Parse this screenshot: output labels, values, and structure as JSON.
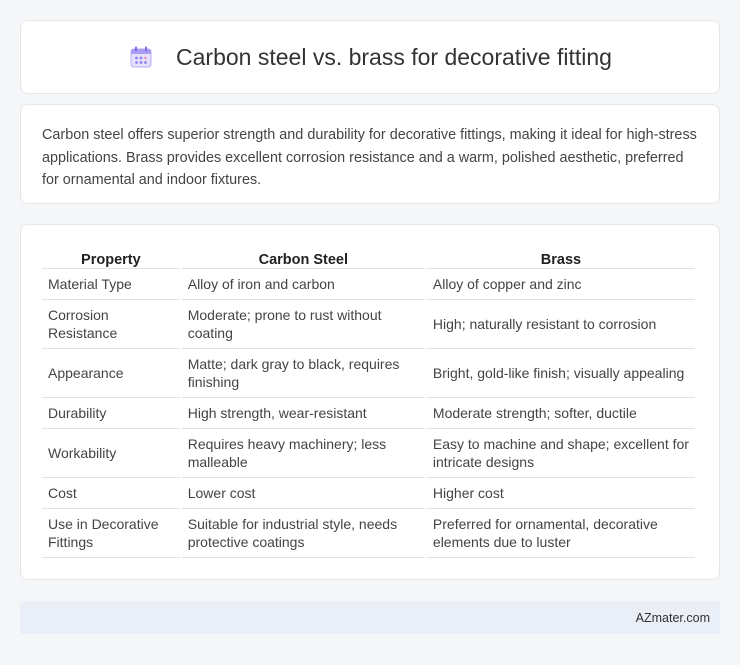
{
  "header": {
    "title": "Carbon steel vs. brass for decorative fitting",
    "icon": "calendar-icon"
  },
  "summary": {
    "text": "Carbon steel offers superior strength and durability for decorative fittings, making it ideal for high-stress applications. Brass provides excellent corrosion resistance and a warm, polished aesthetic, preferred for ornamental and indoor fixtures."
  },
  "table": {
    "headers": [
      "Property",
      "Carbon Steel",
      "Brass"
    ],
    "rows": [
      {
        "property": "Material Type",
        "carbon_steel": "Alloy of iron and carbon",
        "brass": "Alloy of copper and zinc"
      },
      {
        "property": "Corrosion Resistance",
        "carbon_steel": "Moderate; prone to rust without coating",
        "brass": "High; naturally resistant to corrosion"
      },
      {
        "property": "Appearance",
        "carbon_steel": "Matte; dark gray to black, requires finishing",
        "brass": "Bright, gold-like finish; visually appealing"
      },
      {
        "property": "Durability",
        "carbon_steel": "High strength, wear-resistant",
        "brass": "Moderate strength; softer, ductile"
      },
      {
        "property": "Workability",
        "carbon_steel": "Requires heavy machinery; less malleable",
        "brass": "Easy to machine and shape; excellent for intricate designs"
      },
      {
        "property": "Cost",
        "carbon_steel": "Lower cost",
        "brass": "Higher cost"
      },
      {
        "property": "Use in Decorative Fittings",
        "carbon_steel": "Suitable for industrial style, needs protective coatings",
        "brass": "Preferred for ornamental, decorative elements due to luster"
      }
    ]
  },
  "footer": {
    "brand": "AZmater.com"
  },
  "colors": {
    "page_background": "#f5f6f8",
    "card_background": "#ffffff",
    "footer_background": "#e9eef7",
    "icon_accent": "#7b6cf6"
  }
}
